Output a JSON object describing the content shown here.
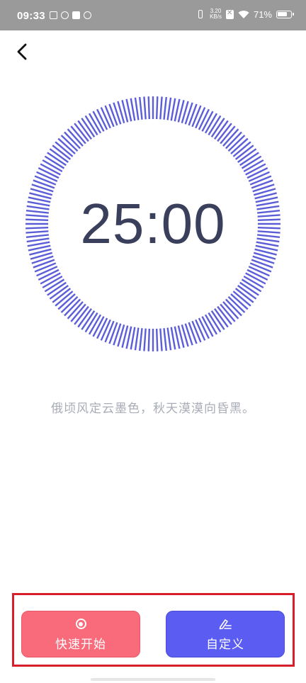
{
  "status_bar": {
    "time": "09:33",
    "net_speed_value": "3.20",
    "net_speed_unit": "KB/s",
    "battery_percent": "71%"
  },
  "timer": {
    "display": "25:00",
    "tick_count": 180,
    "tick_color": "#5c5ed8",
    "text_color": "#3a3f5c"
  },
  "quote": "俄顷风定云墨色，秋天漠漠向昏黑。",
  "buttons": {
    "quick_start_label": "快速开始",
    "quick_start_color": "#f96a7b",
    "custom_label": "自定义",
    "custom_color": "#5a5cf2"
  }
}
